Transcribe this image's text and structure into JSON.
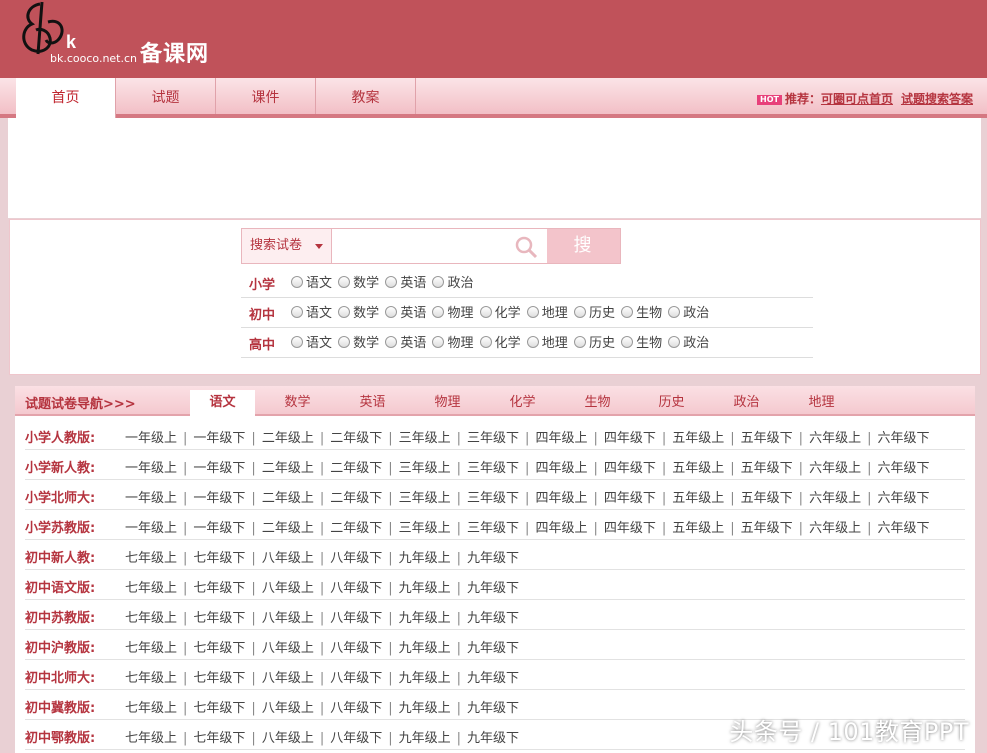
{
  "header": {
    "logo_letters": "Bk",
    "logo_url": "bk.cooco.net.cn",
    "site_name": "备课网"
  },
  "nav": {
    "tabs": [
      {
        "label": "首页",
        "active": true
      },
      {
        "label": "试题",
        "active": false
      },
      {
        "label": "课件",
        "active": false
      },
      {
        "label": "教案",
        "active": false
      }
    ],
    "hot_badge": "HOT",
    "recommend_label": "推荐：",
    "recommend_links": [
      "可圈可点首页",
      "试题搜索答案"
    ]
  },
  "search": {
    "select_value": "搜索试卷",
    "input_value": "",
    "button_label": "搜 索"
  },
  "grade_filters": [
    {
      "label": "小学",
      "subjects": [
        "语文",
        "数学",
        "英语",
        "政治"
      ]
    },
    {
      "label": "初中",
      "subjects": [
        "语文",
        "数学",
        "英语",
        "物理",
        "化学",
        "地理",
        "历史",
        "生物",
        "政治"
      ]
    },
    {
      "label": "高中",
      "subjects": [
        "语文",
        "数学",
        "英语",
        "物理",
        "化学",
        "地理",
        "历史",
        "生物",
        "政治"
      ]
    }
  ],
  "paper_nav": {
    "title": "试题试卷导航>>>",
    "subject_tabs": [
      {
        "label": "语文",
        "active": true
      },
      {
        "label": "数学",
        "active": false
      },
      {
        "label": "英语",
        "active": false
      },
      {
        "label": "物理",
        "active": false
      },
      {
        "label": "化学",
        "active": false
      },
      {
        "label": "生物",
        "active": false
      },
      {
        "label": "历史",
        "active": false
      },
      {
        "label": "政治",
        "active": false
      },
      {
        "label": "地理",
        "active": false
      }
    ],
    "editions": [
      {
        "label": "小学人教版:",
        "grades": [
          "一年级上",
          "一年级下",
          "二年级上",
          "二年级下",
          "三年级上",
          "三年级下",
          "四年级上",
          "四年级下",
          "五年级上",
          "五年级下",
          "六年级上",
          "六年级下"
        ]
      },
      {
        "label": "小学新人教:",
        "grades": [
          "一年级上",
          "一年级下",
          "二年级上",
          "二年级下",
          "三年级上",
          "三年级下",
          "四年级上",
          "四年级下",
          "五年级上",
          "五年级下",
          "六年级上",
          "六年级下"
        ]
      },
      {
        "label": "小学北师大:",
        "grades": [
          "一年级上",
          "一年级下",
          "二年级上",
          "二年级下",
          "三年级上",
          "三年级下",
          "四年级上",
          "四年级下",
          "五年级上",
          "五年级下",
          "六年级上",
          "六年级下"
        ]
      },
      {
        "label": "小学苏教版:",
        "grades": [
          "一年级上",
          "一年级下",
          "二年级上",
          "二年级下",
          "三年级上",
          "三年级下",
          "四年级上",
          "四年级下",
          "五年级上",
          "五年级下",
          "六年级上",
          "六年级下"
        ]
      },
      {
        "label": "初中新人教:",
        "grades": [
          "七年级上",
          "七年级下",
          "八年级上",
          "八年级下",
          "九年级上",
          "九年级下"
        ]
      },
      {
        "label": "初中语文版:",
        "grades": [
          "七年级上",
          "七年级下",
          "八年级上",
          "八年级下",
          "九年级上",
          "九年级下"
        ]
      },
      {
        "label": "初中苏教版:",
        "grades": [
          "七年级上",
          "七年级下",
          "八年级上",
          "八年级下",
          "九年级上",
          "九年级下"
        ]
      },
      {
        "label": "初中沪教版:",
        "grades": [
          "七年级上",
          "七年级下",
          "八年级上",
          "八年级下",
          "九年级上",
          "九年级下"
        ]
      },
      {
        "label": "初中北师大:",
        "grades": [
          "七年级上",
          "七年级下",
          "八年级上",
          "八年级下",
          "九年级上",
          "九年级下"
        ]
      },
      {
        "label": "初中冀教版:",
        "grades": [
          "七年级上",
          "七年级下",
          "八年级上",
          "八年级下",
          "九年级上",
          "九年级下"
        ]
      },
      {
        "label": "初中鄂教版:",
        "grades": [
          "七年级上",
          "七年级下",
          "八年级上",
          "八年级下",
          "九年级上",
          "九年级下"
        ]
      }
    ]
  },
  "watermark": "头条号 / 101教育PPT",
  "colors": {
    "brand": "#c0525a",
    "accent": "#b5343f",
    "page_bg": "#e9d0d4"
  }
}
